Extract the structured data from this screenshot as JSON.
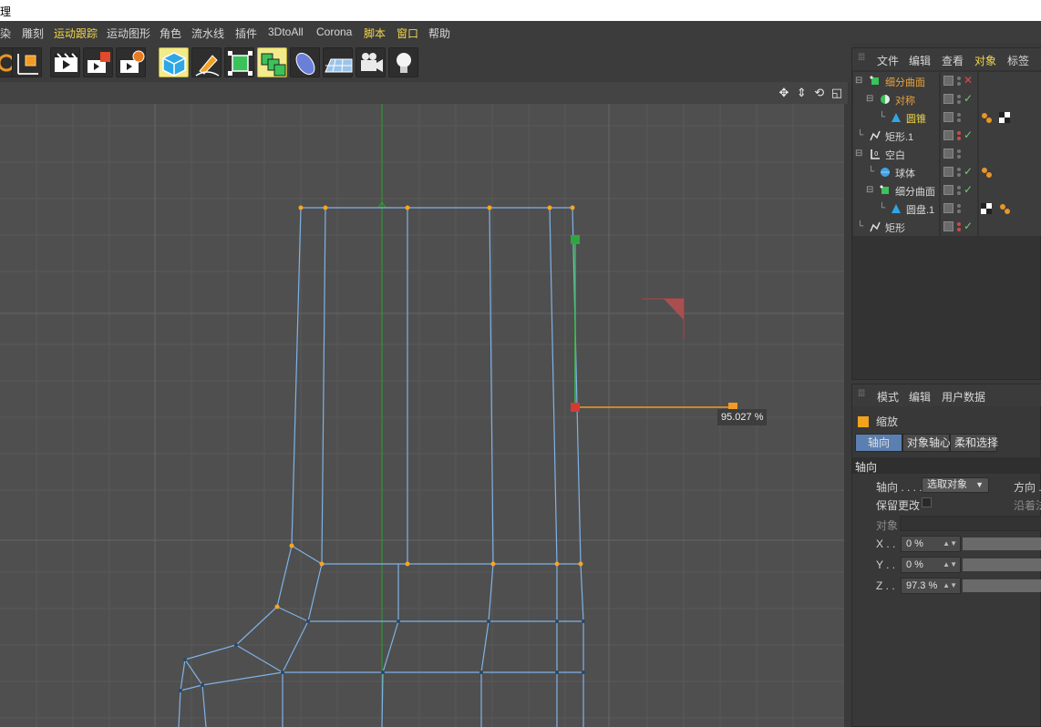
{
  "window": {
    "title": "理"
  },
  "menu": [
    {
      "label": "染",
      "hl": false
    },
    {
      "label": "雕刻",
      "hl": false
    },
    {
      "label": "运动跟踪",
      "hl": true
    },
    {
      "label": "运动图形",
      "hl": false
    },
    {
      "label": "角色",
      "hl": false
    },
    {
      "label": "流水线",
      "hl": false
    },
    {
      "label": "插件",
      "hl": false
    },
    {
      "label": "3DtoAll",
      "hl": false
    },
    {
      "label": "Corona",
      "hl": false
    },
    {
      "label": "脚本",
      "hl": true
    },
    {
      "label": "窗口",
      "hl": true
    },
    {
      "label": "帮助",
      "hl": false
    }
  ],
  "toolbar": {
    "icons": [
      "rotate-icon",
      "coordinate-system-icon",
      "render-region-icon",
      "render-to-picture-viewer-icon",
      "render-settings-icon",
      "cube-icon",
      "pen-icon",
      "subdivision-icon",
      "array-icon",
      "deformer-icon",
      "floor-icon",
      "camera-icon",
      "light-icon"
    ]
  },
  "viewport": {
    "scale_label": "95.027 %",
    "nav_icons": [
      "move-view-icon",
      "zoom-view-icon",
      "rotate-view-icon",
      "maximize-view-icon"
    ]
  },
  "object_manager": {
    "menus": [
      {
        "label": "文件",
        "hl": false
      },
      {
        "label": "编辑",
        "hl": false
      },
      {
        "label": "查看",
        "hl": false
      },
      {
        "label": "对象",
        "hl": true
      },
      {
        "label": "标签",
        "hl": false
      }
    ],
    "objects": [
      {
        "name": "细分曲面",
        "color": "orange",
        "depth": 0,
        "icon": "subdivision-surface-icon",
        "status": "x",
        "tags": []
      },
      {
        "name": "对称",
        "color": "orange",
        "depth": 1,
        "icon": "symmetry-icon",
        "status": "check",
        "tags": []
      },
      {
        "name": "圆锥",
        "color": "yellow",
        "depth": 2,
        "icon": "cone-icon",
        "status": "none",
        "tags": [
          "phong-tag-icon",
          "texture-tag-icon"
        ]
      },
      {
        "name": "矩形.1",
        "color": "white",
        "depth": 0,
        "icon": "spline-icon",
        "status": "check",
        "tags": []
      },
      {
        "name": "空白",
        "color": "white",
        "depth": 0,
        "icon": "null-icon",
        "status": "none",
        "tags": []
      },
      {
        "name": "球体",
        "color": "white",
        "depth": 1,
        "icon": "sphere-icon",
        "status": "check",
        "tags": [
          "phong-tag-icon"
        ]
      },
      {
        "name": "细分曲面",
        "color": "white",
        "depth": 1,
        "icon": "subdivision-surface-icon",
        "status": "check",
        "tags": []
      },
      {
        "name": "圆盘.1",
        "color": "white",
        "depth": 2,
        "icon": "disc-icon",
        "status": "none",
        "tags": [
          "texture-tag-icon",
          "phong-tag-icon"
        ]
      },
      {
        "name": "矩形",
        "color": "white",
        "depth": 0,
        "icon": "spline-icon",
        "status": "check",
        "tags": []
      }
    ]
  },
  "attributes": {
    "menus": [
      "模式",
      "编辑",
      "用户数据"
    ],
    "title": "缩放",
    "tabs": [
      {
        "label": "轴向",
        "active": true
      },
      {
        "label": "对象轴心",
        "active": false
      },
      {
        "label": "柔和选择",
        "active": false
      }
    ],
    "section": "轴向",
    "axis_label": "轴向 . . . .",
    "axis_value": "选取对象",
    "direction_label": "方向 .",
    "keep_changes_label": "保留更改",
    "along_label": "沿着法",
    "object_label": "对象",
    "x_label": "X . .",
    "x_value": "0 %",
    "y_label": "Y . .",
    "y_value": "0 %",
    "z_label": "Z . .",
    "z_value": "97.3 %"
  }
}
